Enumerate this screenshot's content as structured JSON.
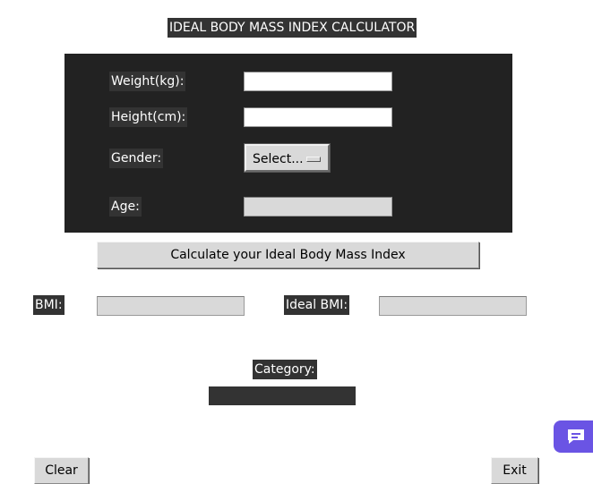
{
  "title": "IDEAL BODY MASS INDEX CALCULATOR",
  "form": {
    "weight_label": "Weight(kg):",
    "weight_value": "",
    "height_label": "Height(cm):",
    "height_value": "",
    "gender_label": "Gender:",
    "gender_selected": "Select...",
    "age_label": "Age:",
    "age_value": ""
  },
  "calculate_button": "Calculate your Ideal Body Mass Index",
  "results": {
    "bmi_label": "BMI:",
    "bmi_value": "",
    "ideal_bmi_label": "Ideal BMI:",
    "ideal_bmi_value": "",
    "category_label": "Category:",
    "category_value": ""
  },
  "footer": {
    "clear_button": "Clear",
    "exit_button": "Exit"
  },
  "colors": {
    "panel_bg": "#222222",
    "label_bg": "#333333",
    "chat_accent": "#6a54e4"
  },
  "icons": {
    "chat": "chat-bubble-icon"
  }
}
